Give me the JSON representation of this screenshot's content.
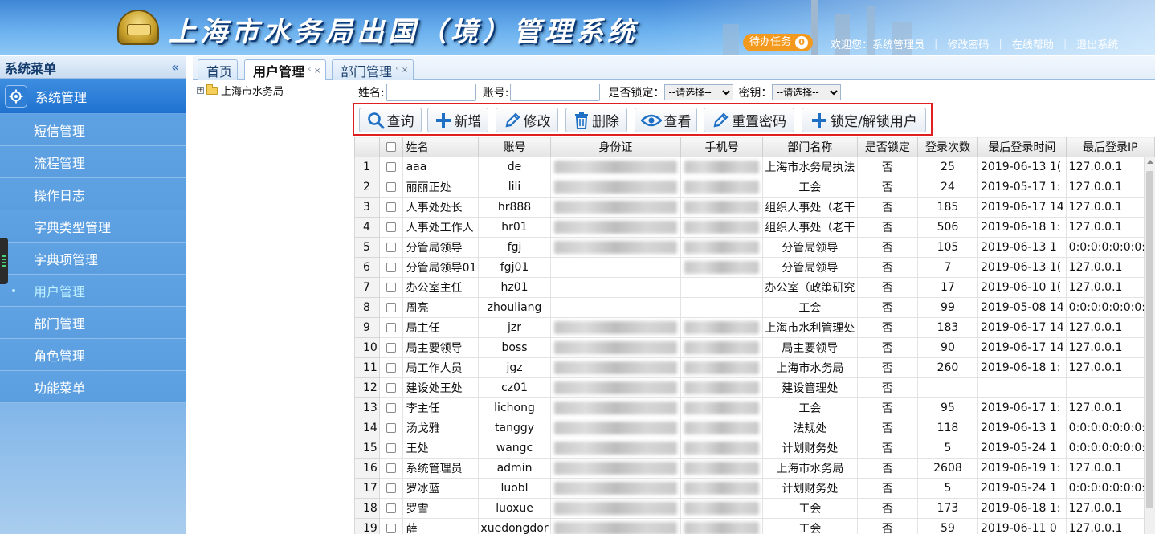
{
  "header": {
    "app_title": "上海市水务局出国（境）管理系统",
    "todo_label": "待办任务",
    "todo_count": "0",
    "welcome": "欢迎您：系统管理员",
    "change_password": "修改密码",
    "online_help": "在线帮助",
    "logout": "退出系统",
    "separator": "|"
  },
  "sidebar": {
    "title": "系统菜单",
    "collapse": "«",
    "group": "系统管理",
    "items": [
      {
        "label": "短信管理"
      },
      {
        "label": "流程管理"
      },
      {
        "label": "操作日志"
      },
      {
        "label": "字典类型管理"
      },
      {
        "label": "字典项管理"
      },
      {
        "label": "用户管理",
        "active": true
      },
      {
        "label": "部门管理"
      },
      {
        "label": "角色管理"
      },
      {
        "label": "功能菜单"
      }
    ]
  },
  "tabs": [
    {
      "label": "首页",
      "closable": false
    },
    {
      "label": "用户管理",
      "closable": true,
      "active": true
    },
    {
      "label": "部门管理",
      "closable": true
    }
  ],
  "tab_close_glyph": "ᶜ ×",
  "tree": {
    "root": "上海市水务局",
    "expander": "+"
  },
  "filter": {
    "name_label": "姓名:",
    "name_value": "",
    "account_label": "账号:",
    "account_value": "",
    "locked_label": "是否锁定：",
    "locked_selected": "--请选择--",
    "secret_label": "密钥：",
    "secret_selected": "--请选择--"
  },
  "toolbar": {
    "query": "查询",
    "add": "新增",
    "edit": "修改",
    "delete": "删除",
    "view": "查看",
    "reset_password": "重置密码",
    "lock_unlock": "锁定/解锁用户"
  },
  "table": {
    "columns": [
      "",
      "",
      "姓名",
      "账号",
      "身份证",
      "手机号",
      "部门名称",
      "是否锁定",
      "登录次数",
      "最后登录时间",
      "最后登录IP"
    ],
    "rows": [
      {
        "no": "1",
        "name": "aaa",
        "account": "de",
        "dept": "上海市水务局执法",
        "locked": "否",
        "logins": "25",
        "last_time": "2019-06-13 1(",
        "ip": "127.0.0.1"
      },
      {
        "no": "2",
        "name": "丽丽正处",
        "account": "lili",
        "dept": "工会",
        "locked": "否",
        "logins": "24",
        "last_time": "2019-05-17 1:",
        "ip": "127.0.0.1"
      },
      {
        "no": "3",
        "name": "人事处处长",
        "account": "hr888",
        "dept": "组织人事处（老干",
        "locked": "否",
        "logins": "185",
        "last_time": "2019-06-17 14",
        "ip": "127.0.0.1"
      },
      {
        "no": "4",
        "name": "人事处工作人",
        "account": "hr01",
        "dept": "组织人事处（老干",
        "locked": "否",
        "logins": "506",
        "last_time": "2019-06-18 1:",
        "ip": "127.0.0.1"
      },
      {
        "no": "5",
        "name": "分管局领导",
        "account": "fgj",
        "dept": "分管局领导",
        "locked": "否",
        "logins": "105",
        "last_time": "2019-06-13 1",
        "ip": "0:0:0:0:0:0:0:1"
      },
      {
        "no": "6",
        "name": "分管局领导01",
        "account": "fgj01",
        "dept": "分管局领导",
        "locked": "否",
        "logins": "7",
        "last_time": "2019-06-13 1(",
        "ip": "127.0.0.1"
      },
      {
        "no": "7",
        "name": "办公室主任",
        "account": "hz01",
        "dept": "办公室（政策研究",
        "locked": "否",
        "logins": "17",
        "last_time": "2019-06-10 1(",
        "ip": "127.0.0.1"
      },
      {
        "no": "8",
        "name": "周亮",
        "account": "zhouliang",
        "dept": "工会",
        "locked": "否",
        "logins": "99",
        "last_time": "2019-05-08 14",
        "ip": "0:0:0:0:0:0:0:1"
      },
      {
        "no": "9",
        "name": "局主任",
        "account": "jzr",
        "dept": "上海市水利管理处",
        "locked": "否",
        "logins": "183",
        "last_time": "2019-06-17 14",
        "ip": "127.0.0.1"
      },
      {
        "no": "10",
        "name": "局主要领导",
        "account": "boss",
        "dept": "局主要领导",
        "locked": "否",
        "logins": "90",
        "last_time": "2019-06-17 14",
        "ip": "127.0.0.1"
      },
      {
        "no": "11",
        "name": "局工作人员",
        "account": "jgz",
        "dept": "上海市水务局",
        "locked": "否",
        "logins": "260",
        "last_time": "2019-06-18 1:",
        "ip": "127.0.0.1"
      },
      {
        "no": "12",
        "name": "建设处王处",
        "account": "cz01",
        "dept": "建设管理处",
        "locked": "否",
        "logins": "",
        "last_time": "",
        "ip": ""
      },
      {
        "no": "13",
        "name": "李主任",
        "account": "lichong",
        "dept": "工会",
        "locked": "否",
        "logins": "95",
        "last_time": "2019-06-17 1:",
        "ip": "127.0.0.1"
      },
      {
        "no": "14",
        "name": "汤戈雅",
        "account": "tanggy",
        "dept": "法规处",
        "locked": "否",
        "logins": "118",
        "last_time": "2019-06-13 1",
        "ip": "0:0:0:0:0:0:0:1"
      },
      {
        "no": "15",
        "name": "王处",
        "account": "wangc",
        "dept": "计划财务处",
        "locked": "否",
        "logins": "5",
        "last_time": "2019-05-24 1",
        "ip": "0:0:0:0:0:0:0:1"
      },
      {
        "no": "16",
        "name": "系统管理员",
        "account": "admin",
        "dept": "上海市水务局",
        "locked": "否",
        "logins": "2608",
        "last_time": "2019-06-19 1:",
        "ip": "127.0.0.1"
      },
      {
        "no": "17",
        "name": "罗冰蓝",
        "account": "luobl",
        "dept": "计划财务处",
        "locked": "否",
        "logins": "5",
        "last_time": "2019-05-24 1",
        "ip": "0:0:0:0:0:0:0:1"
      },
      {
        "no": "18",
        "name": "罗雪",
        "account": "luoxue",
        "dept": "工会",
        "locked": "否",
        "logins": "173",
        "last_time": "2019-06-18 1:",
        "ip": "127.0.0.1"
      },
      {
        "no": "19",
        "name": "薛",
        "account": "xuedongdor",
        "dept": "工会",
        "locked": "否",
        "logins": "59",
        "last_time": "2019-06-11 0",
        "ip": "127.0.0.1"
      }
    ]
  },
  "colors": {
    "accent": "#1f72cf",
    "highlight_border": "#e02020",
    "todo": "#f39a1e"
  }
}
